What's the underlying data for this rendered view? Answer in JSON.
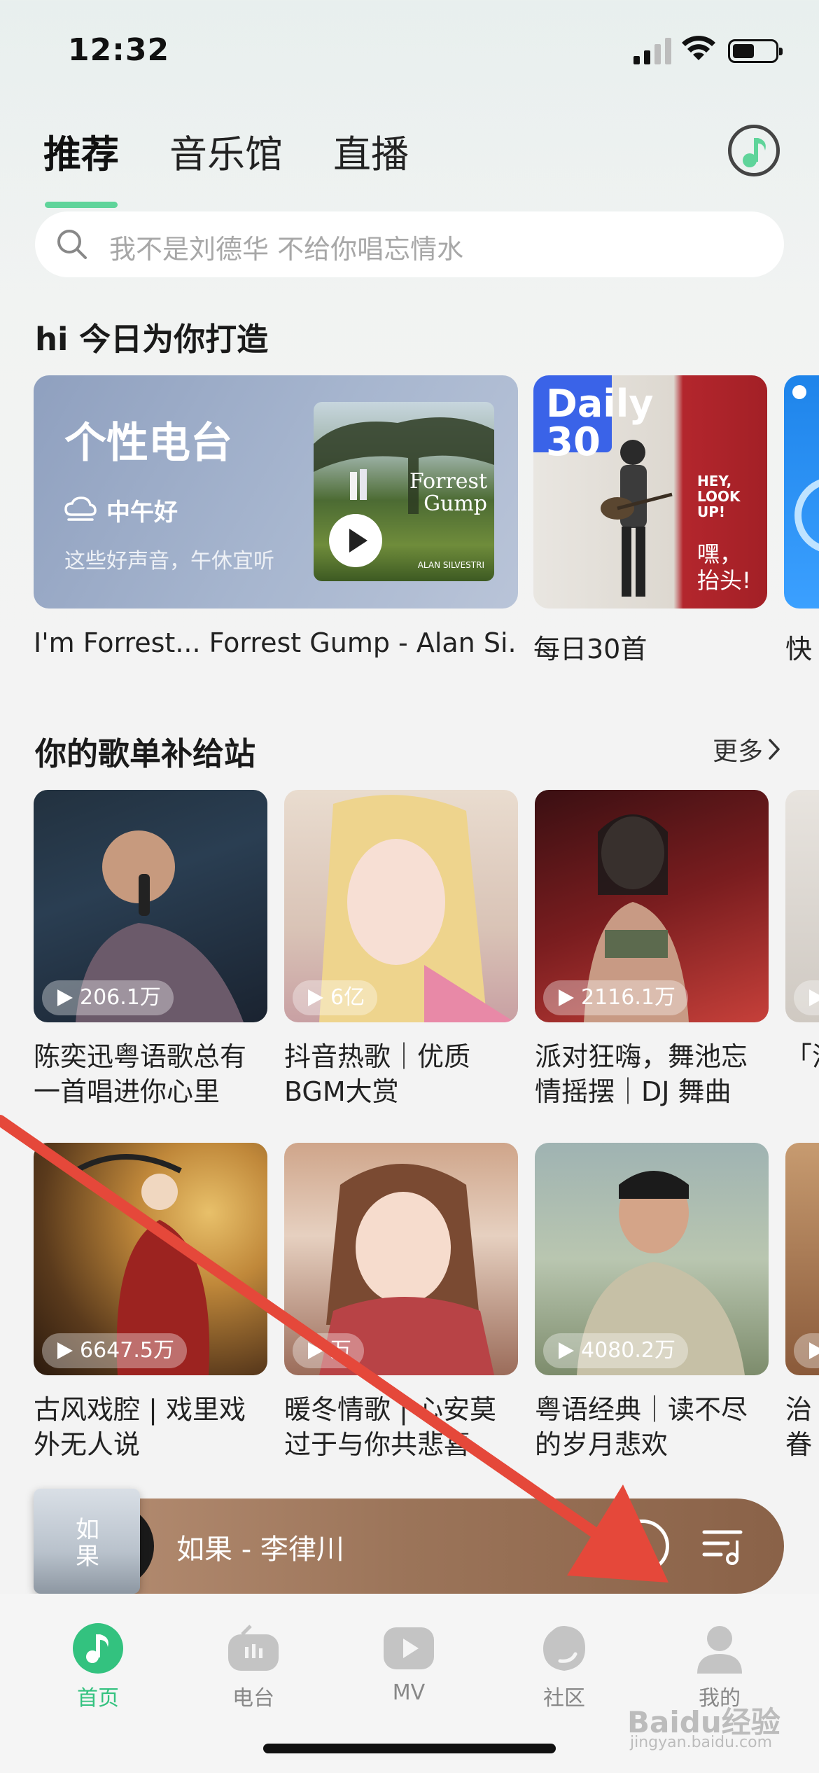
{
  "status": {
    "time": "12:32"
  },
  "tabs": [
    {
      "label": "推荐",
      "active": true
    },
    {
      "label": "音乐馆"
    },
    {
      "label": "直播"
    }
  ],
  "search": {
    "placeholder": "我不是刘德华  不给你唱忘情水"
  },
  "today": {
    "title": "hi 今日为你打造",
    "radio": {
      "title": "个性电台",
      "subtitle": "中午好",
      "desc": "这些好声音，午休宜听",
      "cover_text": "Forrest\nGump",
      "cover_small": "ALAN SILVESTRI",
      "caption": "I'm Forrest... Forrest Gump - Alan Si..."
    },
    "daily": {
      "word": "Daily",
      "num": "30",
      "hey": "HEY,\nLOOK\nUP!",
      "hey2": "嘿，\n抬头!",
      "caption": "每日30首"
    },
    "third_caption": "快"
  },
  "playlists": {
    "title": "你的歌单补给站",
    "more": "更多",
    "items": [
      {
        "count": "206.1万",
        "title": "陈奕迅粤语歌总有一首唱进你心里"
      },
      {
        "count": "6亿",
        "title": "抖音热歌｜优质BGM大赏"
      },
      {
        "count": "2116.1万",
        "title": "派对狂嗨，舞池忘情摇摆｜DJ 舞曲"
      },
      {
        "count": "",
        "title": "「消"
      },
      {
        "count": "6647.5万",
        "title": "古风戏腔 | 戏里戏外无人说"
      },
      {
        "count": "万",
        "title": "暖冬情歌 | 心安莫过于与你共悲喜"
      },
      {
        "count": "4080.2万",
        "title": "粤语经典｜读不尽的岁月悲欢"
      },
      {
        "count": "",
        "title": "治眷"
      }
    ]
  },
  "player": {
    "title": "如果 - 李律川",
    "cover_text": "如\n果"
  },
  "tabbar": [
    {
      "label": "首页",
      "icon": "music-note-icon",
      "active": true
    },
    {
      "label": "电台",
      "icon": "radio-icon"
    },
    {
      "label": "MV",
      "icon": "video-play-icon"
    },
    {
      "label": "社区",
      "icon": "community-icon"
    },
    {
      "label": "我的",
      "icon": "user-icon"
    }
  ],
  "watermark": {
    "main": "Baidu经验",
    "sub": "jingyan.baidu.com"
  },
  "colors": {
    "accent": "#33c27f",
    "arrow": "#e5483a",
    "player": "#9b7459"
  }
}
